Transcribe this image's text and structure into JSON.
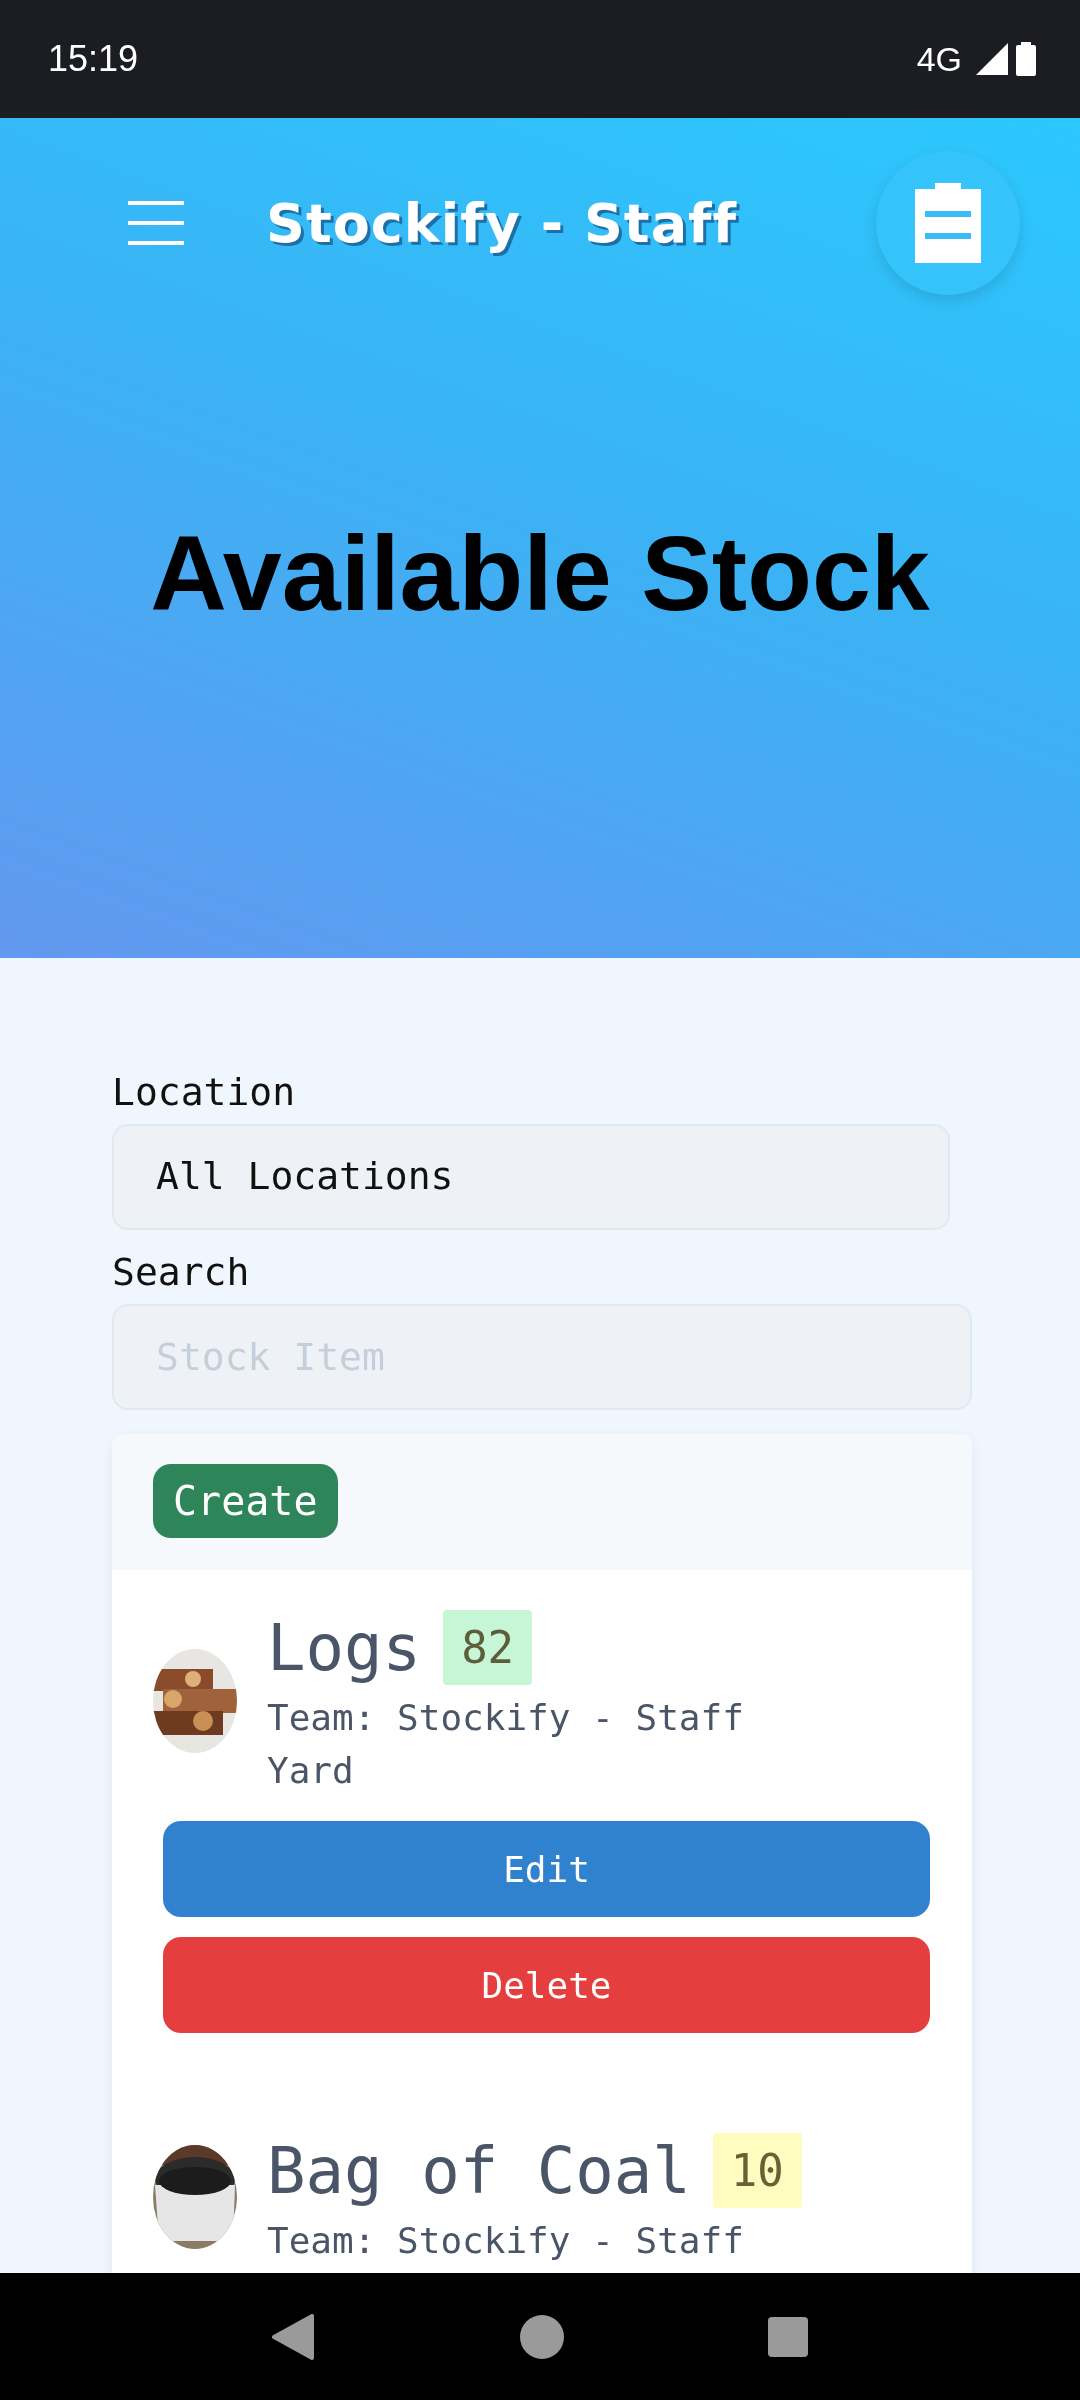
{
  "status_bar": {
    "time": "15:19",
    "network": "4G"
  },
  "header": {
    "title": "Stockify - Staff"
  },
  "hero": {
    "title": "Available Stock"
  },
  "filters": {
    "location_label": "Location",
    "location_value": "All Locations",
    "search_label": "Search",
    "search_placeholder": "Stock Item"
  },
  "create_button": "Create",
  "items": [
    {
      "name": "Logs",
      "quantity": "82",
      "color": "#c6f6d5",
      "team": "Team: Stockify - Staff",
      "location": "Yard",
      "buttons": [
        "Edit",
        "Delete"
      ]
    },
    {
      "name": "Bag of Coal",
      "quantity": "10",
      "color": "#fefcbf",
      "team": "Team: Stockify - Staff"
    }
  ]
}
